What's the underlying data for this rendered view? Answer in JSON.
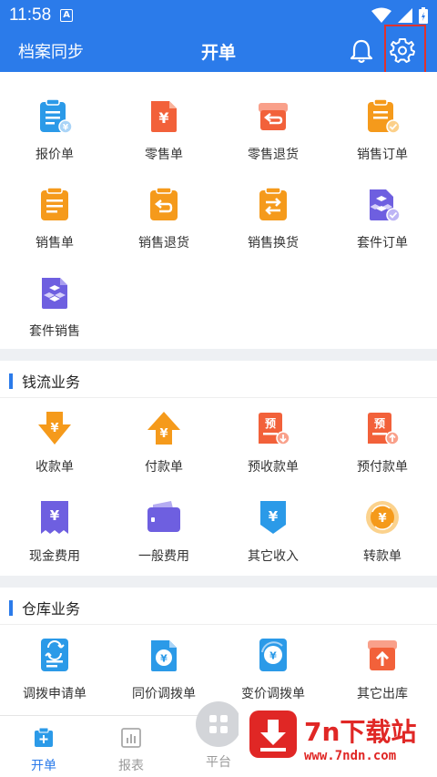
{
  "status_bar": {
    "time": "11:58",
    "badge": "A"
  },
  "header": {
    "left_label": "档案同步",
    "title": "开单",
    "bell_icon": "bell-icon",
    "settings_icon": "gear-icon"
  },
  "colors": {
    "primary": "#2b7bea",
    "orange": "#f59a1b",
    "red": "#f2613a",
    "purple": "#6e5fe0",
    "highlight": "#e0322d"
  },
  "sales": {
    "items": [
      {
        "label": "报价单",
        "icon": "quotation-icon"
      },
      {
        "label": "零售单",
        "icon": "retail-order-icon"
      },
      {
        "label": "零售退货",
        "icon": "retail-return-icon"
      },
      {
        "label": "销售订单",
        "icon": "sales-order-icon"
      },
      {
        "label": "销售单",
        "icon": "sales-slip-icon"
      },
      {
        "label": "销售退货",
        "icon": "sales-return-icon"
      },
      {
        "label": "销售换货",
        "icon": "sales-exchange-icon"
      },
      {
        "label": "套件订单",
        "icon": "bundle-order-icon"
      },
      {
        "label": "套件销售",
        "icon": "bundle-sale-icon"
      }
    ]
  },
  "cash": {
    "title": "钱流业务",
    "items": [
      {
        "label": "收款单",
        "icon": "receipt-icon"
      },
      {
        "label": "付款单",
        "icon": "payment-icon"
      },
      {
        "label": "预收款单",
        "icon": "advance-receipt-icon"
      },
      {
        "label": "预付款单",
        "icon": "advance-payment-icon"
      },
      {
        "label": "现金费用",
        "icon": "cash-expense-icon"
      },
      {
        "label": "一般费用",
        "icon": "wallet-icon"
      },
      {
        "label": "其它收入",
        "icon": "other-income-icon"
      },
      {
        "label": "转款单",
        "icon": "transfer-icon"
      }
    ]
  },
  "warehouse": {
    "title": "仓库业务",
    "items": [
      {
        "label": "调拨申请单",
        "icon": "transfer-request-icon"
      },
      {
        "label": "同价调拨单",
        "icon": "same-price-transfer-icon"
      },
      {
        "label": "变价调拨单",
        "icon": "price-change-transfer-icon"
      },
      {
        "label": "其它出库",
        "icon": "other-outbound-icon"
      }
    ]
  },
  "bottom_nav": {
    "tabs": [
      {
        "label": "开单",
        "icon": "order-icon",
        "active": true
      },
      {
        "label": "报表",
        "icon": "report-icon",
        "active": false
      },
      {
        "label": "平台",
        "icon": "platform-icon",
        "active": false
      }
    ]
  },
  "watermark": {
    "title": "7n下载站",
    "url": "www.7ndn.com"
  }
}
